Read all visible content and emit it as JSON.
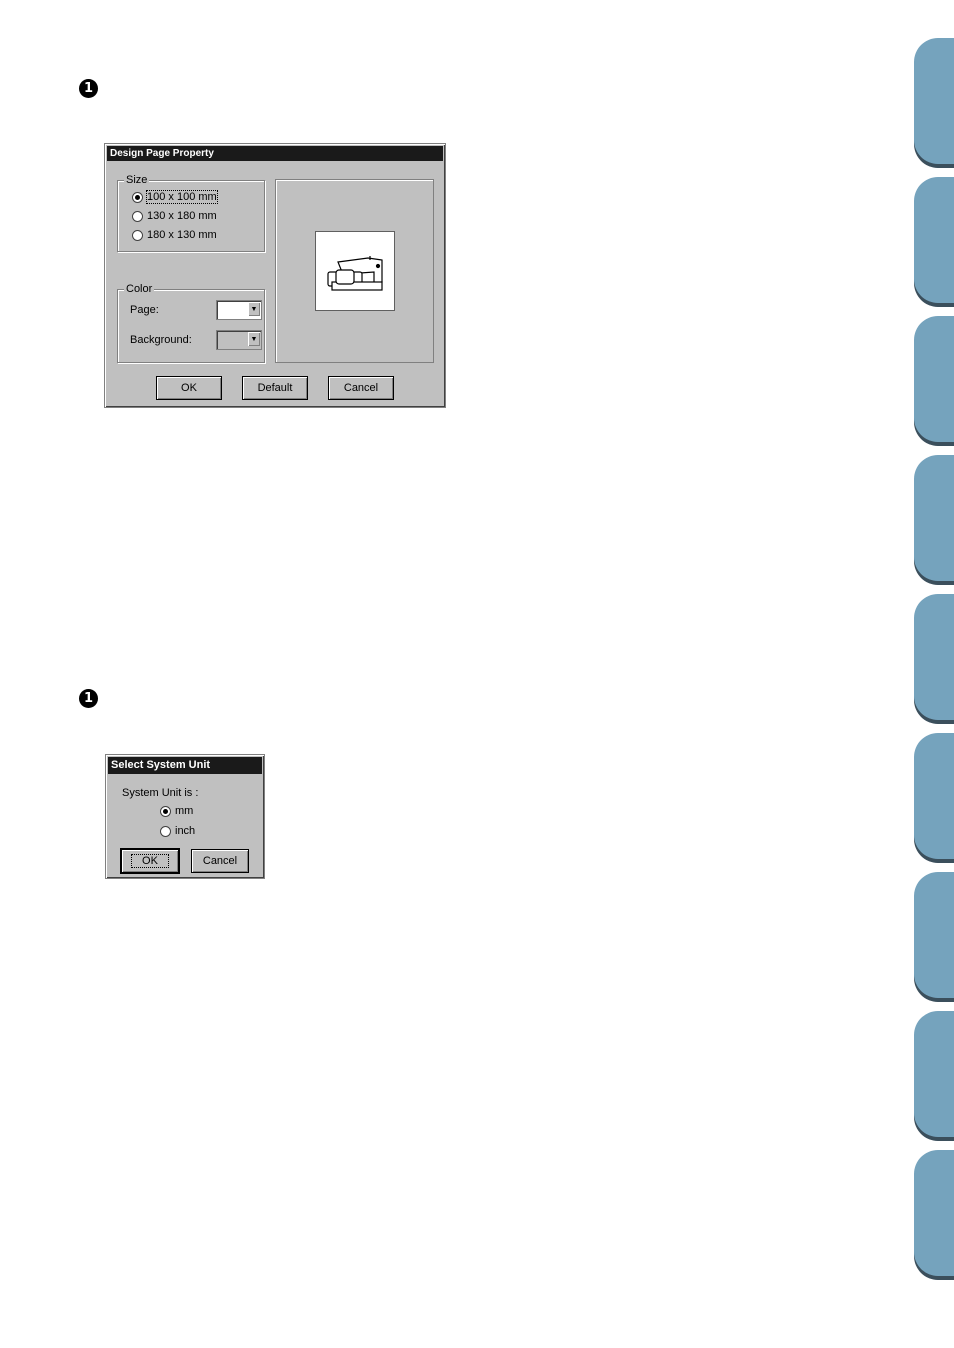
{
  "steps": {
    "step1": "1",
    "step2": "1"
  },
  "design_page_dialog": {
    "title": "Design Page Property",
    "size_group": {
      "legend": "Size",
      "options": [
        {
          "label": "100 x 100 mm",
          "selected": true
        },
        {
          "label": "130 x 180 mm",
          "selected": false
        },
        {
          "label": "180 x 130 mm",
          "selected": false
        }
      ]
    },
    "color_group": {
      "legend": "Color",
      "page_label": "Page:",
      "page_color": "#ffffff",
      "background_label": "Background:",
      "background_color": "#c0c0c0"
    },
    "preview_icon": "sewing-machine-icon",
    "buttons": {
      "ok": "OK",
      "default": "Default",
      "cancel": "Cancel"
    }
  },
  "system_unit_dialog": {
    "title": "Select System Unit",
    "prompt": "System Unit is :",
    "options": [
      {
        "label": "mm",
        "selected": true
      },
      {
        "label": "inch",
        "selected": false
      }
    ],
    "buttons": {
      "ok": "OK",
      "cancel": "Cancel"
    }
  },
  "side_tabs_color": "#75a3bd"
}
